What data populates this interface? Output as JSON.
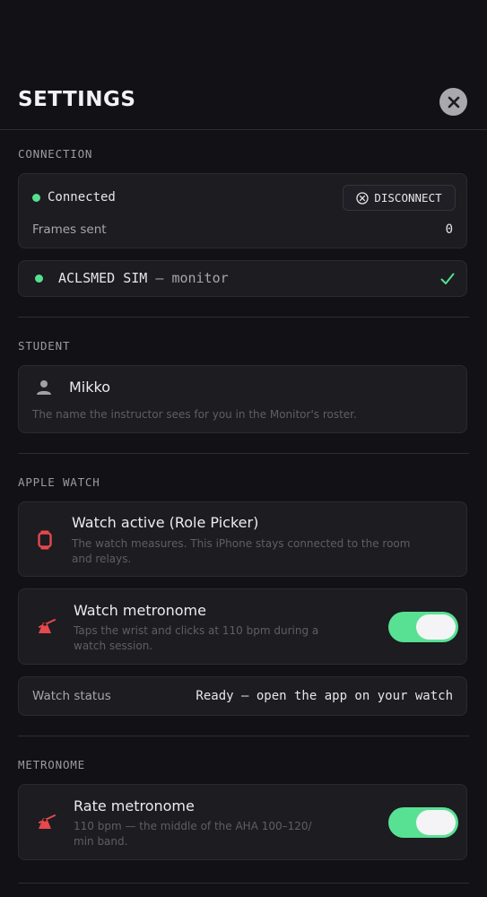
{
  "header": {
    "title": "SETTINGS"
  },
  "connection": {
    "section_label": "CONNECTION",
    "status_text": "Connected",
    "disconnect_label": "DISCONNECT",
    "frames_label": "Frames sent",
    "frames_value": "0",
    "room_name": "ACLSMED SIM",
    "room_separator": "—",
    "room_role": "monitor",
    "status_color": "#55e08f"
  },
  "student": {
    "section_label": "STUDENT",
    "name": "Mikko",
    "hint": "The name the instructor sees for you in the Monitor's roster."
  },
  "apple_watch": {
    "section_label": "APPLE WATCH",
    "active_title": "Watch active (Role Picker)",
    "active_desc_1": "The watch measures. This iPhone stays connected to the room",
    "active_desc_2": "and relays.",
    "metronome_title": "Watch metronome",
    "metronome_desc_1": "Taps the wrist and clicks at 110 bpm during a",
    "metronome_desc_2": "watch session.",
    "metronome_on": true,
    "status_label": "Watch status",
    "status_value": "Ready — open the app on your watch"
  },
  "metronome": {
    "section_label": "METRONOME",
    "rate_title": "Rate metronome",
    "rate_desc_1": "110 bpm — the middle of the AHA 100–120/",
    "rate_desc_2": "min band.",
    "rate_on": true
  },
  "colors": {
    "accent": "#58e193",
    "alert": "#e5484d",
    "background": "#121216"
  }
}
